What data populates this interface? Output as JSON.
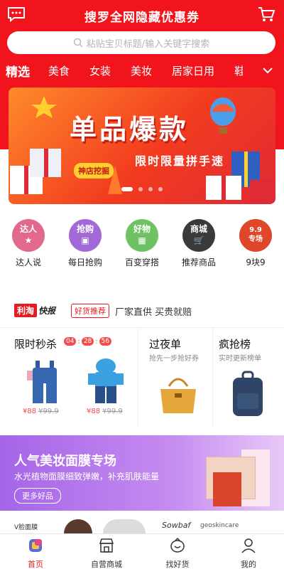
{
  "header": {
    "title": "搜罗全网隐藏优惠券",
    "search_placeholder": "粘贴宝贝标题/输入关键字搜索"
  },
  "categories": [
    "精选",
    "美食",
    "女装",
    "美妆",
    "居家日用",
    "鞋"
  ],
  "banner": {
    "headline": "单品爆款",
    "subline": "限时限量拼手速",
    "tag": "神店挖掘",
    "slide_count": 4,
    "active_slide": 1
  },
  "shortcuts": [
    {
      "icon_text": "达人",
      "label": "达人说",
      "color": "#e2688e"
    },
    {
      "icon_text": "抢购",
      "label": "每日抢购",
      "color": "#a26ad6"
    },
    {
      "icon_text": "好物",
      "label": "百变穿搭",
      "color": "#6ec264"
    },
    {
      "icon_text": "商城",
      "label": "推荐商品",
      "color": "#3a3a3a"
    },
    {
      "icon_text": "9.9\n专场",
      "label": "9块9",
      "color": "#e0462a"
    }
  ],
  "news": {
    "logo_a": "利淘",
    "logo_b": "快报",
    "badge": "好货推荐",
    "text": "厂家直供 买贵就赔"
  },
  "deals": {
    "flash": {
      "title": "限时秒杀",
      "timer": [
        "04",
        "28",
        "56"
      ],
      "items": [
        {
          "price": "¥88",
          "orig": "¥99.9"
        },
        {
          "price": "¥88",
          "orig": "¥99.9"
        }
      ]
    },
    "overnight": {
      "title": "过夜单",
      "sub": "抢先一步抢好券"
    },
    "hot": {
      "title": "疯抢榜",
      "sub": "实时更新榜单"
    }
  },
  "beauty": {
    "title": "人气美妆面膜专场",
    "sub": "水光植物面膜细致弹嫩，补充肌肤能量",
    "button": "更多好品"
  },
  "strip": {
    "left": "V脸面膜",
    "brand1": "Sowbaf",
    "brand2": "geoskincare"
  },
  "tabbar": [
    {
      "label": "首页",
      "icon": "home-icon",
      "active": true
    },
    {
      "label": "自营商城",
      "icon": "store-icon",
      "active": false
    },
    {
      "label": "找好货",
      "icon": "find-goods-icon",
      "active": false
    },
    {
      "label": "我的",
      "icon": "profile-icon",
      "active": false
    }
  ],
  "colors": {
    "brand_red": "#f1141c",
    "accent_red": "#e41b23"
  }
}
